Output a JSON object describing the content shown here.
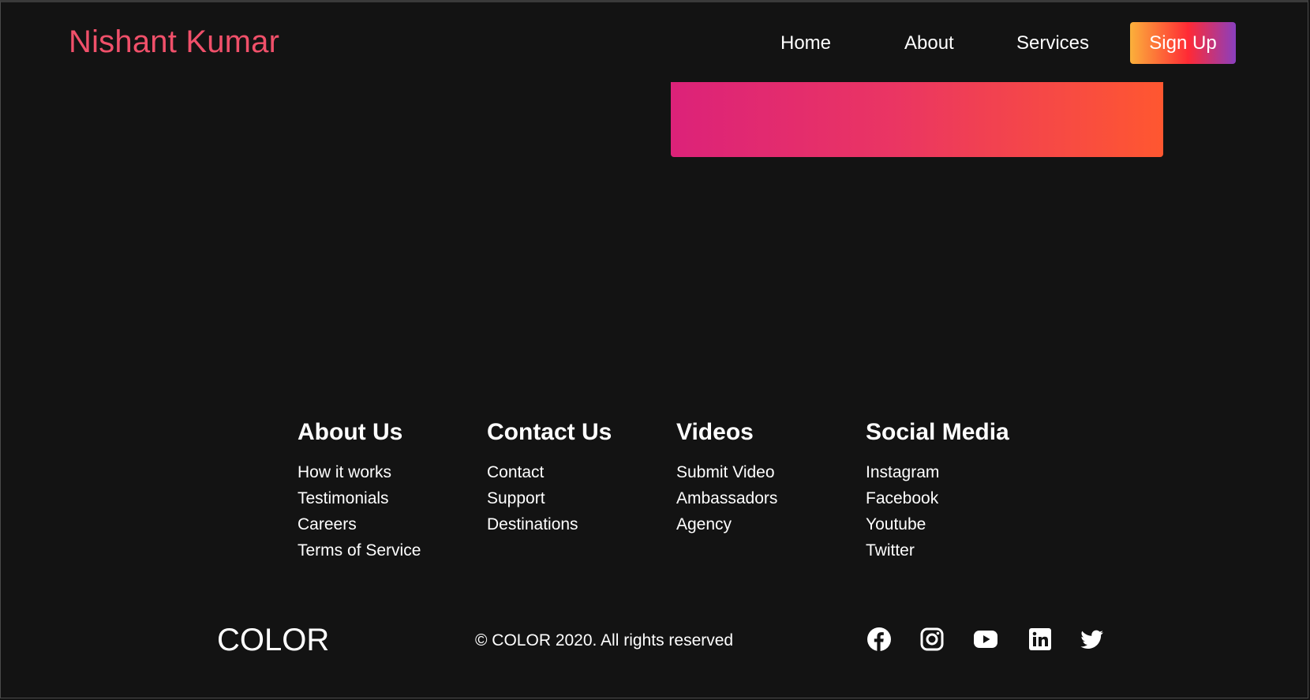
{
  "header": {
    "brand": "Nishant Kumar",
    "nav": {
      "home": "Home",
      "about": "About",
      "services": "Services"
    },
    "signup_label": "Sign Up"
  },
  "colors": {
    "background": "#131313",
    "brand": "#f0506a",
    "signup_gradient": [
      "#fbb03b",
      "#ff2a35",
      "#8a3fbf"
    ],
    "hero_gradient": [
      "#dc2279",
      "#ff5730"
    ]
  },
  "footer": {
    "columns": [
      {
        "title": "About Us",
        "links": [
          "How it works",
          "Testimonials",
          "Careers",
          "Terms of Service"
        ]
      },
      {
        "title": "Contact Us",
        "links": [
          "Contact",
          "Support",
          "Destinations"
        ]
      },
      {
        "title": "Videos",
        "links": [
          "Submit Video",
          "Ambassadors",
          "Agency"
        ]
      },
      {
        "title": "Social Media",
        "links": [
          "Instagram",
          "Facebook",
          "Youtube",
          "Twitter"
        ]
      }
    ],
    "logo": "COLOR",
    "copyright": "© COLOR 2020. All rights reserved",
    "social_icons": [
      "facebook-icon",
      "instagram-icon",
      "youtube-icon",
      "linkedin-icon",
      "twitter-icon"
    ]
  }
}
